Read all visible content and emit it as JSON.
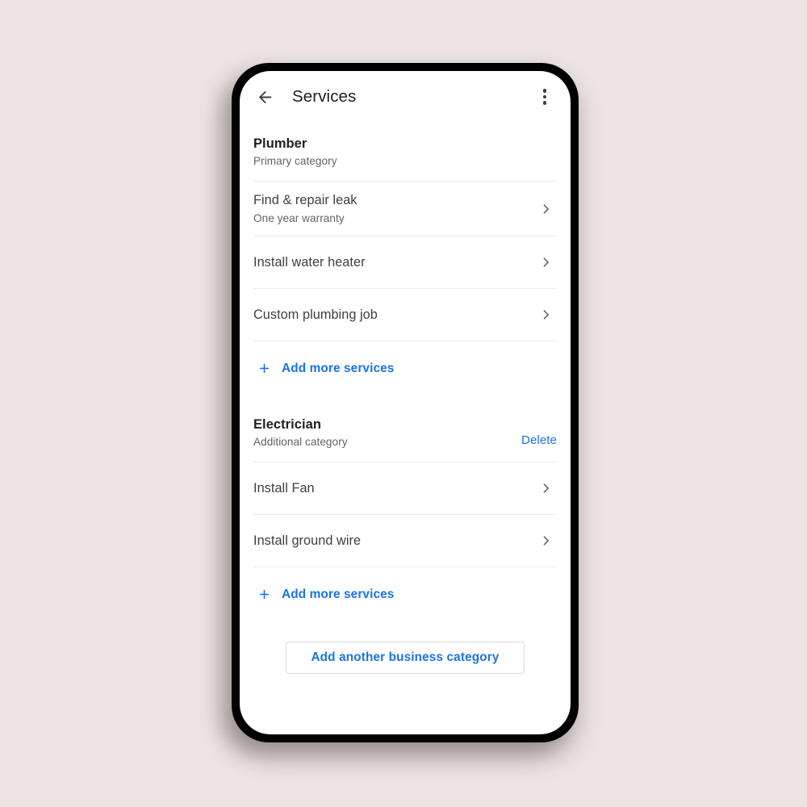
{
  "app": {
    "title": "Services",
    "back_icon": "arrow-left-icon",
    "overflow_icon": "more-vertical-icon"
  },
  "categories": [
    {
      "name": "Plumber",
      "subtitle": "Primary category",
      "delete_label": null,
      "services": [
        {
          "title": "Find & repair leak",
          "subtitle": "One year warranty"
        },
        {
          "title": "Install water heater",
          "subtitle": null
        },
        {
          "title": "Custom plumbing job",
          "subtitle": null
        }
      ],
      "add_more_label": "Add more services"
    },
    {
      "name": "Electrician",
      "subtitle": "Additional category",
      "delete_label": "Delete",
      "services": [
        {
          "title": "Install Fan",
          "subtitle": null
        },
        {
          "title": "Install ground wire",
          "subtitle": null
        }
      ],
      "add_more_label": "Add more services"
    }
  ],
  "footer": {
    "add_category_label": "Add another business category"
  },
  "colors": {
    "accent_blue": "#1a73e8",
    "text_primary": "#202124",
    "text_secondary": "#5f6368",
    "divider": "#e8eaed",
    "page_background": "#ece4e3",
    "frame": "#000000"
  }
}
